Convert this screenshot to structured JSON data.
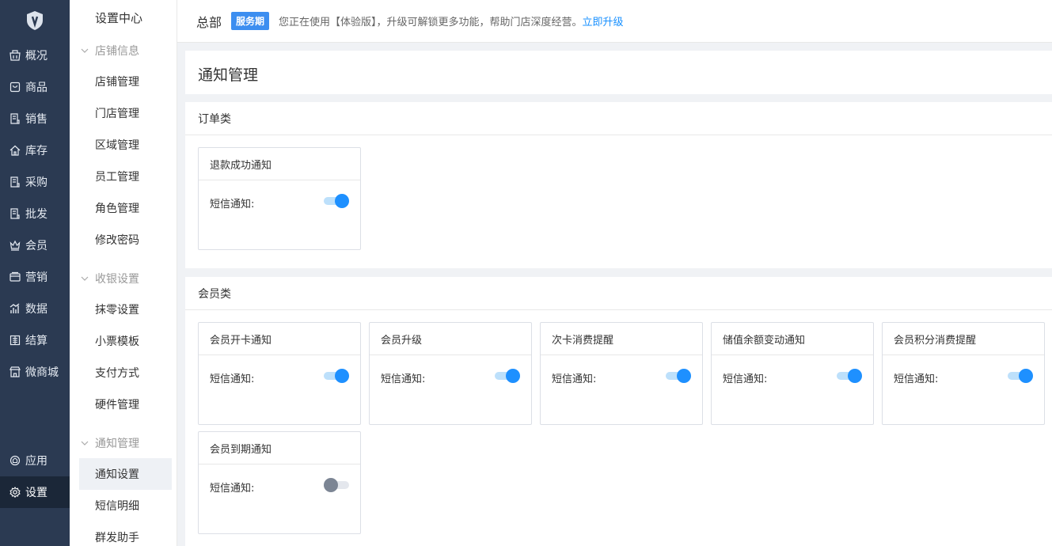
{
  "nav": {
    "items": [
      {
        "label": "概况",
        "icon": "shop-icon"
      },
      {
        "label": "商品",
        "icon": "bag-icon"
      },
      {
        "label": "销售",
        "icon": "receipt-icon"
      },
      {
        "label": "库存",
        "icon": "warehouse-icon"
      },
      {
        "label": "采购",
        "icon": "purchase-icon"
      },
      {
        "label": "批发",
        "icon": "wholesale-icon"
      },
      {
        "label": "会员",
        "icon": "crown-icon"
      },
      {
        "label": "营销",
        "icon": "card-icon"
      },
      {
        "label": "数据",
        "icon": "chart-icon"
      },
      {
        "label": "结算",
        "icon": "ledger-icon"
      },
      {
        "label": "微商城",
        "icon": "store-icon"
      }
    ],
    "bottom": [
      {
        "label": "应用",
        "icon": "app-icon"
      },
      {
        "label": "设置",
        "icon": "gear-icon"
      }
    ]
  },
  "submenu": {
    "title": "设置中心",
    "groups": [
      {
        "label": "店铺信息",
        "items": [
          "店铺管理",
          "门店管理",
          "区域管理",
          "员工管理",
          "角色管理",
          "修改密码"
        ]
      },
      {
        "label": "收银设置",
        "items": [
          "抹零设置",
          "小票模板",
          "支付方式",
          "硬件管理"
        ]
      },
      {
        "label": "通知管理",
        "items": [
          "通知设置",
          "短信明细",
          "群发助手"
        ]
      }
    ],
    "active": "通知设置"
  },
  "header": {
    "title": "总部",
    "badge": "服务期",
    "text": "您正在使用【体验版】，升级可解锁更多功能，帮助门店深度经营。",
    "link": "立即升级"
  },
  "page": {
    "title": "通知管理"
  },
  "sections": [
    {
      "title": "订单类",
      "cards": [
        {
          "title": "退款成功通知",
          "row_label": "短信通知:",
          "enabled": true
        }
      ]
    },
    {
      "title": "会员类",
      "cards": [
        {
          "title": "会员开卡通知",
          "row_label": "短信通知:",
          "enabled": true
        },
        {
          "title": "会员升级",
          "row_label": "短信通知:",
          "enabled": true
        },
        {
          "title": "次卡消费提醒",
          "row_label": "短信通知:",
          "enabled": true
        },
        {
          "title": "储值余额变动通知",
          "row_label": "短信通知:",
          "enabled": true
        },
        {
          "title": "会员积分消费提醒",
          "row_label": "短信通知:",
          "enabled": true
        },
        {
          "title": "会员到期通知",
          "row_label": "短信通知:",
          "enabled": false
        }
      ]
    }
  ],
  "colors": {
    "nav_bg": "#2b3a52",
    "accent": "#1e90ff",
    "badge": "#3c8ef0"
  }
}
